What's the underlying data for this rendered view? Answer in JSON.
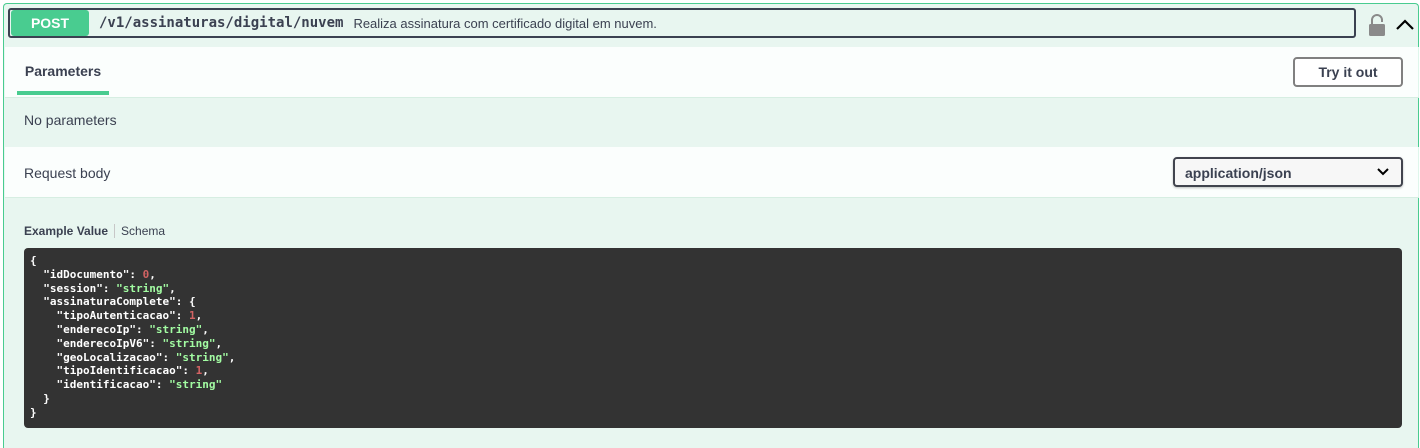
{
  "operation": {
    "method": "POST",
    "path": "/v1/assinaturas/digital/nuvem",
    "description": "Realiza assinatura com certificado digital em nuvem."
  },
  "icons": {
    "lock": "lock-icon",
    "collapse": "chevron-up-icon",
    "select": "chevron-down-icon"
  },
  "colors": {
    "post_accent": "#49cc90",
    "post_bg": "#e8f6f0",
    "code_bg": "#333333",
    "code_string": "#a2fca2",
    "code_number": "#d36363"
  },
  "parameters": {
    "tab_label": "Parameters",
    "try_button": "Try it out",
    "empty_text": "No parameters"
  },
  "request_body": {
    "label": "Request body",
    "content_type": "application/json"
  },
  "example": {
    "tab_value": "Example Value",
    "tab_schema": "Schema",
    "lines": [
      {
        "t": "{"
      },
      {
        "t": "  ",
        "key": "\"idDocumento\"",
        "sep": ": ",
        "val": "0",
        "vt": "n",
        "end": ","
      },
      {
        "t": "  ",
        "key": "\"session\"",
        "sep": ": ",
        "val": "\"string\"",
        "vt": "s",
        "end": ","
      },
      {
        "t": "  ",
        "key": "\"assinaturaComplete\"",
        "sep": ": {",
        "val": "",
        "vt": "",
        "end": ""
      },
      {
        "t": "    ",
        "key": "\"tipoAutenticacao\"",
        "sep": ": ",
        "val": "1",
        "vt": "n",
        "end": ","
      },
      {
        "t": "    ",
        "key": "\"enderecoIp\"",
        "sep": ": ",
        "val": "\"string\"",
        "vt": "s",
        "end": ","
      },
      {
        "t": "    ",
        "key": "\"enderecoIpV6\"",
        "sep": ": ",
        "val": "\"string\"",
        "vt": "s",
        "end": ","
      },
      {
        "t": "    ",
        "key": "\"geoLocalizacao\"",
        "sep": ": ",
        "val": "\"string\"",
        "vt": "s",
        "end": ","
      },
      {
        "t": "    ",
        "key": "\"tipoIdentificacao\"",
        "sep": ": ",
        "val": "1",
        "vt": "n",
        "end": ","
      },
      {
        "t": "    ",
        "key": "\"identificacao\"",
        "sep": ": ",
        "val": "\"string\"",
        "vt": "s",
        "end": ""
      },
      {
        "t": "  }"
      },
      {
        "t": "}"
      }
    ]
  }
}
